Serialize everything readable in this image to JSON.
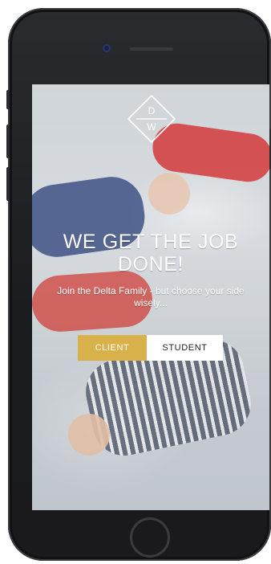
{
  "device": {
    "name": "iPhone"
  },
  "landing": {
    "logo": {
      "letters_top": "D",
      "letters_bottom": "W"
    },
    "headline": "WE GET THE JOB DONE!",
    "subhead": "Join the Delta Family - but choose your side wisely...",
    "buttons": {
      "client": "CLIENT",
      "student": "STUDENT"
    }
  },
  "colors": {
    "accent": "#D9B14B",
    "phone_body": "#1B1C1F",
    "text": "#FFFFFF"
  },
  "icons": {
    "logo": "diamond-dw-logo",
    "camera": "front-camera",
    "speaker": "earpiece-speaker",
    "home": "home-button"
  }
}
